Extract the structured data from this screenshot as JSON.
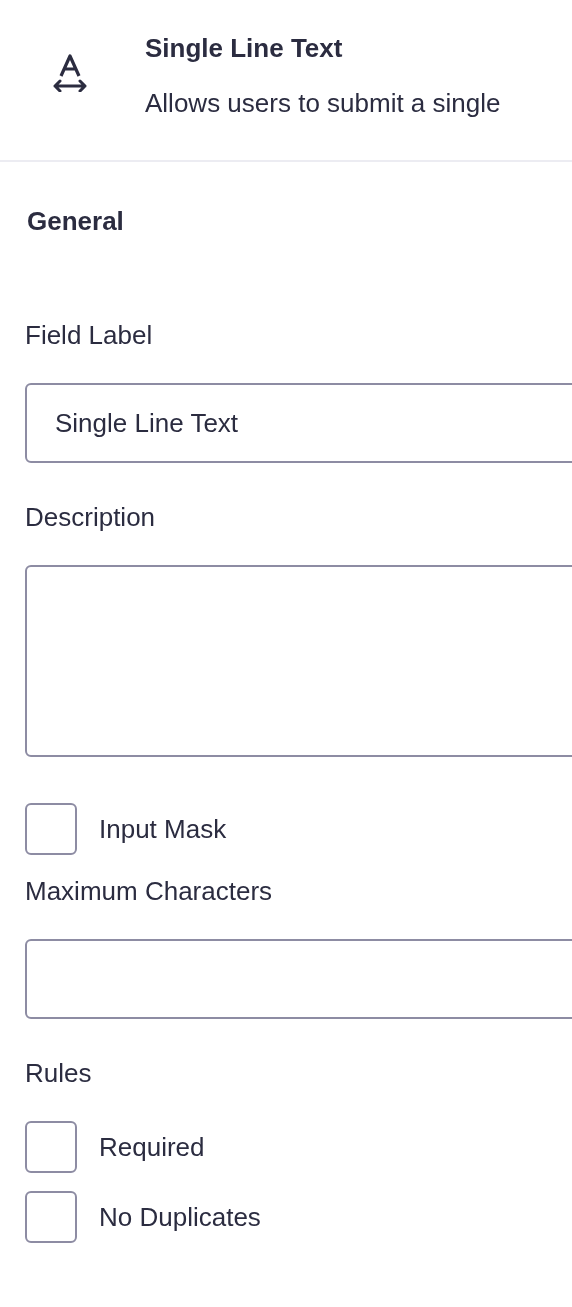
{
  "header": {
    "title": "Single Line Text",
    "description": "Allows users to submit a single"
  },
  "section_title": "General",
  "fields": [
    {
      "kind": "text",
      "label": "Field Label",
      "value": "Single Line Text"
    },
    {
      "kind": "textarea",
      "label": "Description"
    },
    {
      "kind": "checkbox",
      "label": "Input Mask",
      "checked": false
    },
    {
      "kind": "text",
      "label": "Maximum Characters"
    },
    {
      "kind": "checklist",
      "label": "Rules",
      "options": [
        {
          "label": "Required",
          "checked": false
        },
        {
          "label": "No Duplicates",
          "checked": false
        }
      ]
    }
  ]
}
